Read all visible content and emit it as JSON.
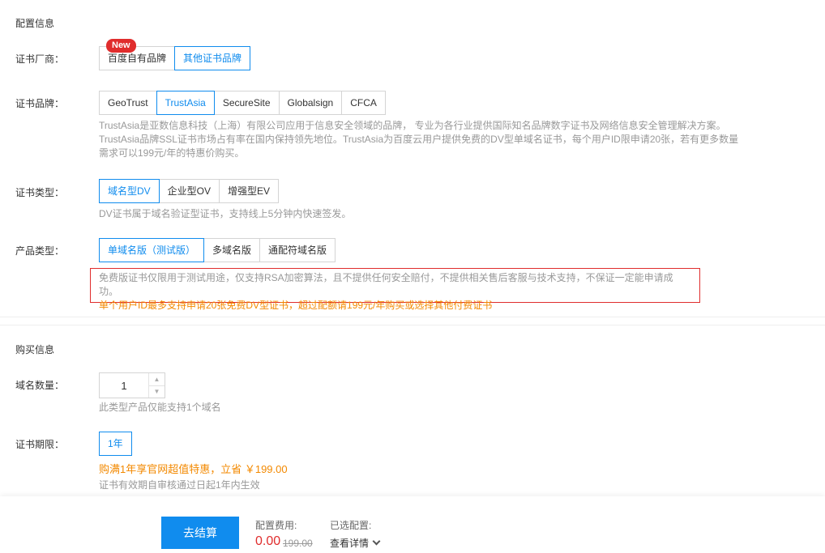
{
  "config_section": {
    "title": "配置信息",
    "vendor": {
      "label": "证书厂商：",
      "badge": "New",
      "options": [
        "百度自有品牌",
        "其他证书品牌"
      ],
      "active": 1
    },
    "brand": {
      "label": "证书品牌：",
      "options": [
        "GeoTrust",
        "TrustAsia",
        "SecureSite",
        "Globalsign",
        "CFCA"
      ],
      "active": 1,
      "desc_line1": "TrustAsia是亚数信息科技（上海）有限公司应用于信息安全领域的品牌， 专业为各行业提供国际知名品牌数字证书及网络信息安全管理解决方案。",
      "desc_line2": "TrustAsia品牌SSL证书市场占有率在国内保持领先地位。TrustAsia为百度云用户提供免费的DV型单域名证书，每个用户ID限申请20张，若有更多数量",
      "desc_line3": "需求可以199元/年的特惠价购买。"
    },
    "type": {
      "label": "证书类型：",
      "options": [
        "域名型DV",
        "企业型OV",
        "增强型EV"
      ],
      "active": 0,
      "desc": "DV证书属于域名验证型证书，支持线上5分钟内快速签发。"
    },
    "product": {
      "label": "产品类型：",
      "options": [
        "单域名版（测试版）",
        "多域名版",
        "通配符域名版"
      ],
      "active": 0,
      "warning_line1": "免费版证书仅限用于测试用途，仅支持RSA加密算法，且不提供任何安全赔付，不提供相关售后客服与技术支持，不保证一定能申请成功。",
      "warning_line2": "单个用户ID最多支持申请20张免费DV型证书，超过配额请199元/年购买或选择其他付费证书"
    }
  },
  "purchase_section": {
    "title": "购买信息",
    "domain_count": {
      "label": "域名数量：",
      "value": "1",
      "hint": "此类型产品仅能支持1个域名"
    },
    "period": {
      "label": "证书期限：",
      "option": "1年",
      "promo": "购满1年享官网超值特惠，立省 ￥199.00",
      "hint": "证书有效期自审核通过日起1年内生效"
    }
  },
  "footer": {
    "checkout_label": "去结算",
    "fee_label": "配置费用:",
    "fee_price": "0.00",
    "fee_original": "199.00",
    "config_label": "已选配置:",
    "config_link": "查看详情"
  },
  "colors": {
    "accent": "#108cee",
    "danger": "#e02d2d",
    "promo": "#f38900"
  }
}
